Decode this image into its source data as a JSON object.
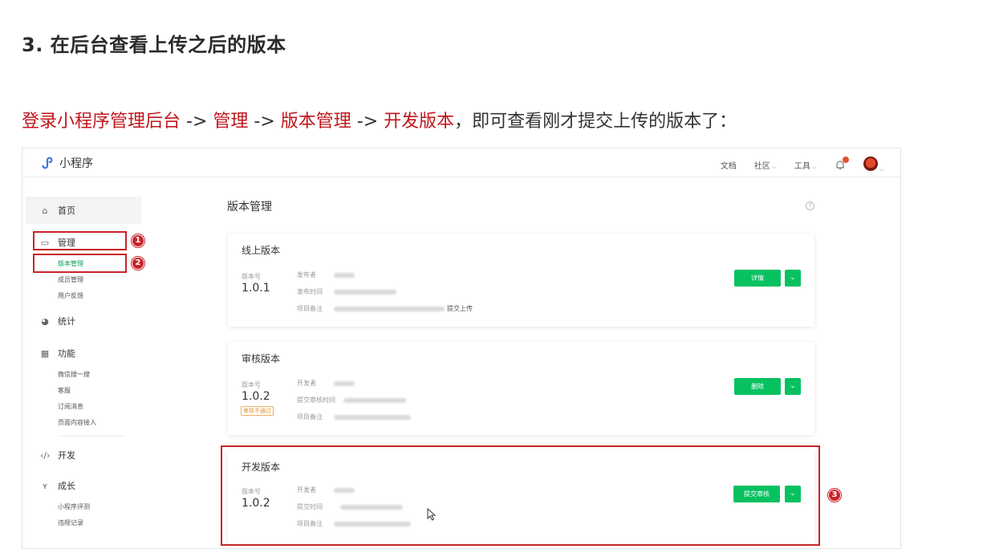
{
  "doc": {
    "heading": "3. 在后台查看上传之后的版本",
    "para": {
      "step1": "登录小程序管理后台",
      "arrow1": " -> ",
      "step2": "管理",
      "arrow2": " -> ",
      "step3": "版本管理",
      "arrow3": " -> ",
      "step4": "开发版本",
      "tail": "，即可查看刚才提交上传的版本了："
    }
  },
  "app": {
    "brand": "小程序",
    "topnav": {
      "docs": "文档",
      "community": "社区",
      "tools": "工具"
    },
    "sidebar": {
      "home": "首页",
      "manage": "管理",
      "manage_items": [
        "版本管理",
        "成员管理",
        "用户反馈"
      ],
      "stats": "统计",
      "features": "功能",
      "feature_items": [
        "微信搜一搜",
        "客服",
        "订阅消息",
        "页面内容接入"
      ],
      "dev": "开发",
      "growth": "成长",
      "growth_items": [
        "小程序评测",
        "违规记录"
      ]
    },
    "page_title": "版本管理",
    "cards": {
      "online": {
        "title": "线上版本",
        "ver_label": "版本号",
        "version": "1.0.1",
        "field1": "发布者",
        "field2": "发布时间",
        "field3": "项目备注",
        "remark_tail": "提交上传",
        "button": "详情"
      },
      "review": {
        "title": "审核版本",
        "ver_label": "版本号",
        "version": "1.0.2",
        "badge": "审核不通过",
        "field1": "开发者",
        "field2": "提交审核时间",
        "field3": "项目备注",
        "button": "删除"
      },
      "dev": {
        "title": "开发版本",
        "ver_label": "版本号",
        "version": "1.0.2",
        "field1": "开发者",
        "field2": "提交时间",
        "field3": "项目备注",
        "button": "提交审核"
      }
    },
    "markers": [
      "1",
      "2",
      "3"
    ]
  }
}
